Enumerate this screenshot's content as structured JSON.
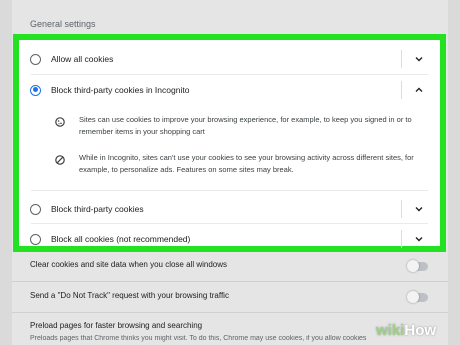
{
  "section": {
    "label": "General settings"
  },
  "cookie_options": [
    {
      "label": "Allow all cookies",
      "selected": false,
      "expanded": false
    },
    {
      "label": "Block third-party cookies in Incognito",
      "selected": true,
      "expanded": true
    },
    {
      "label": "Block third-party cookies",
      "selected": false,
      "expanded": false
    },
    {
      "label": "Block all cookies (not recommended)",
      "selected": false,
      "expanded": false
    }
  ],
  "details": [
    {
      "icon": "cookie-icon",
      "text": "Sites can use cookies to improve your browsing experience, for example, to keep you signed in or to remember items in your shopping cart"
    },
    {
      "icon": "block-icon",
      "text": "While in Incognito, sites can't use your cookies to see your browsing activity across different sites, for example, to personalize ads. Features on some sites may break."
    }
  ],
  "settings": [
    {
      "label": "Clear cookies and site data when you close all windows",
      "enabled": false
    },
    {
      "label": "Send a \"Do Not Track\" request with your browsing traffic",
      "enabled": false
    },
    {
      "label": "Preload pages for faster browsing and searching",
      "description": "Preloads pages that Chrome thinks you might visit. To do this, Chrome may use cookies, if you allow cookies"
    }
  ],
  "watermark": {
    "part1": "wiki",
    "part2": "How"
  },
  "colors": {
    "highlight": "#22e222",
    "accent": "#1a73e8"
  }
}
